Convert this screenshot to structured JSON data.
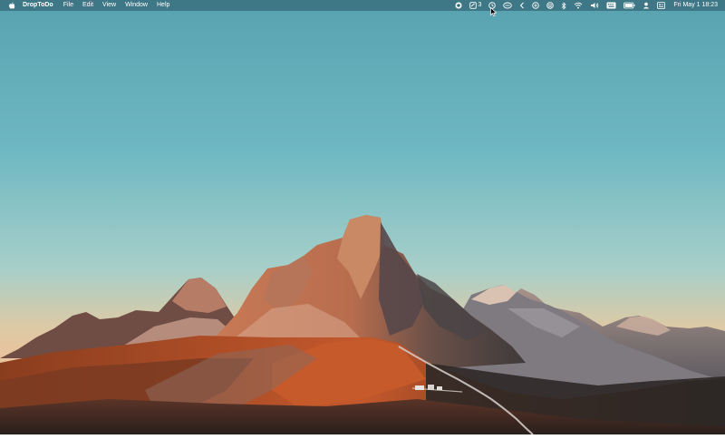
{
  "menubar": {
    "app_name": "DropToDo",
    "menus": [
      "File",
      "Edit",
      "View",
      "Window",
      "Help"
    ],
    "status_icons": [
      "record-icon",
      "notes-icon",
      "clock-icon",
      "glasses-icon",
      "chevron-left-icon",
      "plus-circle-icon",
      "layers-icon",
      "bluetooth-icon",
      "wifi-icon",
      "volume-icon",
      "keyboard-icon",
      "battery-icon",
      "user-icon",
      "control-center-icon"
    ],
    "notes_count": "3",
    "datetime": "Fri May 1  18:23"
  },
  "colors": {
    "sky_top": "#5aa4b2",
    "sky_bottom": "#e3c9a4",
    "menubar": "#386e7c"
  }
}
